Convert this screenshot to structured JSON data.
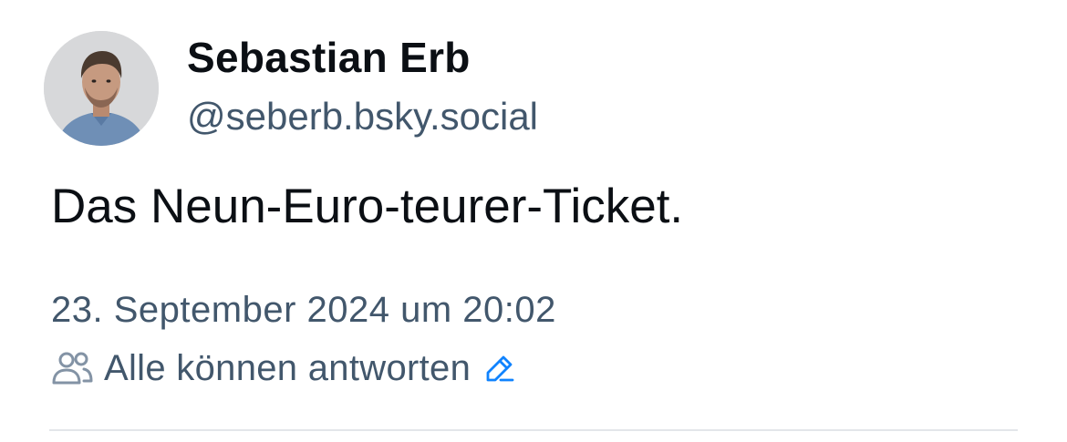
{
  "author": {
    "display_name": "Sebastian Erb",
    "handle": "@seberb.bsky.social",
    "avatar_icon": "profile-photo"
  },
  "post": {
    "text": "Das Neun-Euro-teurer-Ticket.",
    "timestamp": "23. September 2024 um 20:02"
  },
  "reply_settings": {
    "icon": "people-icon",
    "label": "Alle können antworten",
    "edit_icon": "pencil-icon"
  },
  "colors": {
    "primary_text": "#0b0f14",
    "secondary_text": "#42576c",
    "accent": "#1083fe",
    "divider": "#e3e6ea"
  }
}
